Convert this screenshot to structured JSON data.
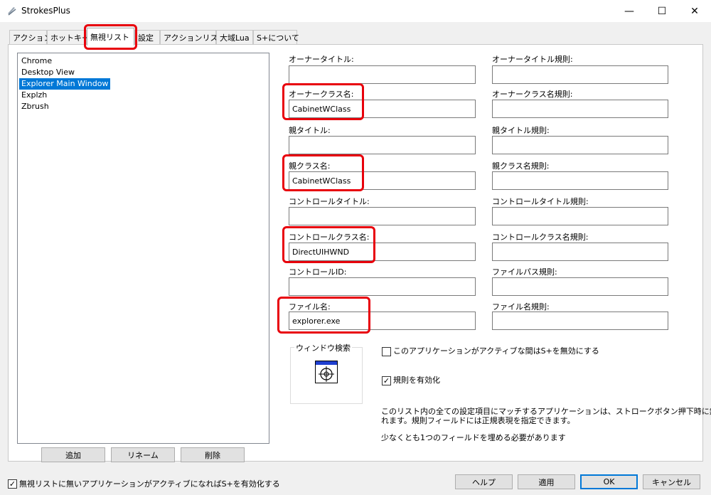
{
  "window": {
    "title": "StrokesPlus",
    "minimize": "—",
    "maximize": "☐",
    "close": "✕"
  },
  "tabs": [
    {
      "label": "アクション"
    },
    {
      "label": "ホットキー"
    },
    {
      "label": "無視リスト"
    },
    {
      "label": "設定"
    },
    {
      "label": "アクションリスト"
    },
    {
      "label": "大域Lua"
    },
    {
      "label": "S+について"
    }
  ],
  "ignore_list": {
    "items": [
      "Chrome",
      "Desktop View",
      "Explorer Main Window",
      "Explzh",
      "Zbrush"
    ],
    "selected": "Explorer Main Window",
    "add_label": "追加",
    "rename_label": "リネーム",
    "delete_label": "削除"
  },
  "fields": {
    "owner_title": {
      "label": "オーナータイトル:",
      "value": ""
    },
    "owner_title_regex": {
      "label": "オーナータイトル規則:",
      "value": ""
    },
    "owner_class": {
      "label": "オーナークラス名:",
      "value": "CabinetWClass"
    },
    "owner_class_regex": {
      "label": "オーナークラス名規則:",
      "value": ""
    },
    "parent_title": {
      "label": "親タイトル:",
      "value": ""
    },
    "parent_title_regex": {
      "label": "親タイトル規則:",
      "value": ""
    },
    "parent_class": {
      "label": "親クラス名:",
      "value": "CabinetWClass"
    },
    "parent_class_regex": {
      "label": "親クラス名規則:",
      "value": ""
    },
    "control_title": {
      "label": "コントロールタイトル:",
      "value": ""
    },
    "control_title_regex": {
      "label": "コントロールタイトル規則:",
      "value": ""
    },
    "control_class": {
      "label": "コントロールクラス名:",
      "value": "DirectUIHWND"
    },
    "control_class_regex": {
      "label": "コントロールクラス名規則:",
      "value": ""
    },
    "control_id": {
      "label": "コントロールID:",
      "value": ""
    },
    "file_path_regex": {
      "label": "ファイルパス規則:",
      "value": ""
    },
    "file_name": {
      "label": "ファイル名:",
      "value": "explorer.exe"
    },
    "file_name_regex": {
      "label": "ファイル名規則:",
      "value": ""
    }
  },
  "window_finder": {
    "label": "ウィンドウ検索"
  },
  "options": {
    "disable_when_active": {
      "label": "このアプリケーションがアクティブな間はS+を無効にする",
      "checked": false
    },
    "enable_regex": {
      "label": "規則を有効化",
      "checked": true
    }
  },
  "description": {
    "line1": "このリスト内の全ての設定項目にマッチするアプリケーションは、ストロークボタン押下時に無視さ",
    "line2": "れます。規則フィールドには正規表現を指定できます。",
    "line3": "少なくとも1つのフィールドを埋める必要があります"
  },
  "footer": {
    "enable_not_listed": {
      "label": "無視リストに無いアプリケーションがアクティブになればS+を有効化する",
      "checked": true
    },
    "help_label": "ヘルプ",
    "apply_label": "適用",
    "ok_label": "OK",
    "cancel_label": "キャンセル"
  },
  "colors": {
    "highlight": "#e8000b",
    "selection": "#0078d7"
  }
}
